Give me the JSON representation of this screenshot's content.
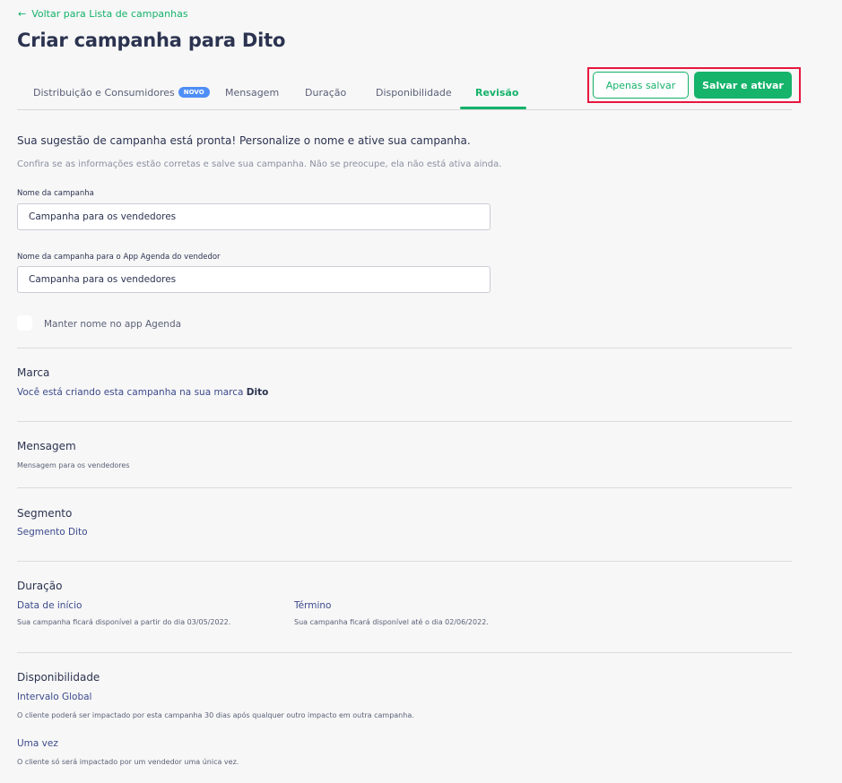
{
  "back_link": "Voltar para Lista de campanhas",
  "page_title": "Criar campanha para Dito",
  "tabs": [
    {
      "label": "Distribuição e Consumidores",
      "badge": "NOVO"
    },
    {
      "label": "Mensagem"
    },
    {
      "label": "Duração"
    },
    {
      "label": "Disponibilidade"
    },
    {
      "label": "Revisão",
      "active": true
    }
  ],
  "actions": {
    "save_only": "Apenas salvar",
    "save_activate": "Salvar e ativar"
  },
  "intro": {
    "heading": "Sua sugestão de campanha está pronta! Personalize o nome e ative sua campanha.",
    "subtext": "Confira se as informações estão corretas e salve sua campanha. Não se preocupe, ela não está ativa ainda."
  },
  "form": {
    "campaign_name_label": "Nome da campanha",
    "campaign_name_value": "Campanha para os vendedores",
    "agenda_name_label": "Nome da campanha para o App Agenda do vendedor",
    "agenda_name_value": "Campanha para os vendedores",
    "keep_name_label": "Manter nome no app Agenda"
  },
  "sections": {
    "brand": {
      "title": "Marca",
      "text": "Você está criando esta campanha na sua marca",
      "brand_name": "Dito"
    },
    "message": {
      "title": "Mensagem",
      "text": "Mensagem para os vendedores"
    },
    "segment": {
      "title": "Segmento",
      "text": "Segmento Dito"
    },
    "duration": {
      "title": "Duração",
      "start_label": "Data de início",
      "start_text": "Sua campanha ficará disponível a partir do dia 03/05/2022.",
      "end_label": "Término",
      "end_text": "Sua campanha ficará disponível até o dia 02/06/2022."
    },
    "availability": {
      "title": "Disponibilidade",
      "global_label": "Intervalo Global",
      "global_text": "O cliente poderá ser impactado por esta campanha 30 dias após qualquer outro impacto em outra campanha.",
      "once_label": "Uma vez",
      "once_text": "O cliente só será impactado por um vendedor uma única vez."
    }
  },
  "colors": {
    "accent": "#14b26a",
    "highlight_border": "#e8163f",
    "badge": "#4e8ef7",
    "text_dark": "#2b3350"
  }
}
